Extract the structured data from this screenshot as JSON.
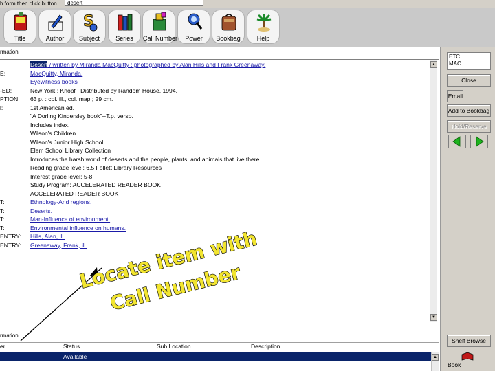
{
  "top_bar": {
    "prompt": "h form then click button",
    "search_value": "desert"
  },
  "toolbar": {
    "buttons": [
      {
        "label": "Title",
        "icon": "book-icon"
      },
      {
        "label": "Author",
        "icon": "pen-icon"
      },
      {
        "label": "Subject",
        "icon": "subject-icon"
      },
      {
        "label": "Series",
        "icon": "books-icon"
      },
      {
        "label": "Call Number",
        "icon": "call-number-icon"
      },
      {
        "label": "Power",
        "icon": "power-icon"
      },
      {
        "label": "Bookbag",
        "icon": "bookbag-icon"
      },
      {
        "label": "Help",
        "icon": "help-icon"
      }
    ]
  },
  "detail": {
    "section_title": "rmation",
    "rows": [
      {
        "label": "",
        "value": "Desert / written by Miranda MacQuitty ; photographed by Alan Hills and Frank Greenaway.",
        "link": true,
        "highlight_word": "Desert"
      },
      {
        "label": "E:",
        "value": "MacQuitty, Miranda.",
        "link": true
      },
      {
        "label": "",
        "value": "Eyewitness books",
        "link": true
      },
      {
        "label": "-ED:",
        "value": "New York : Knopf : Distributed by Random House, 1994.",
        "link": false
      },
      {
        "label": "PTION:",
        "value": "63 p. : col. ill., col. map ; 29 cm.",
        "link": false
      },
      {
        "label": "l:",
        "value": "1st American ed.",
        "link": false
      },
      {
        "label": "",
        "value": "\"A Dorling Kindersley book\"--T.p. verso.",
        "link": false
      },
      {
        "label": "",
        "value": "Includes index.",
        "link": false
      },
      {
        "label": "",
        "value": "Wilson's Children",
        "link": false
      },
      {
        "label": "",
        "value": "Wilson's Junior High School",
        "link": false
      },
      {
        "label": "",
        "value": "Elem School Library Collection",
        "link": false
      },
      {
        "label": "",
        "value": "Introduces the harsh world of deserts and the people, plants, and animals that live there.",
        "link": false
      },
      {
        "label": "",
        "value": "Reading grade level: 6.5 Follett Library Resources",
        "link": false
      },
      {
        "label": "",
        "value": "Interest grade level: 5-8",
        "link": false
      },
      {
        "label": "",
        "value": "Study Program: ACCELERATED READER BOOK",
        "link": false
      },
      {
        "label": "",
        "value": "ACCELERATED READER BOOK",
        "link": false
      },
      {
        "label": "T:",
        "value": "Ethnology-Arid regions.",
        "link": true
      },
      {
        "label": "T:",
        "value": "Deserts.",
        "link": true
      },
      {
        "label": "T:",
        "value": "Man-Influence of environment.",
        "link": true
      },
      {
        "label": "T:",
        "value": "Environmental influence on humans.",
        "link": true
      },
      {
        "label": "ENTRY:",
        "value": "Hills, Alan, ill.",
        "link": true
      },
      {
        "label": "ENTRY:",
        "value": "Greenaway, Frank, ill.",
        "link": true
      }
    ]
  },
  "right_panel": {
    "info_lines": [
      "ETC",
      "MAC"
    ],
    "buttons": {
      "close": "Close",
      "email": "Email",
      "add_bookbag": "Add to Bookbag",
      "hold": "Hold/Reserve"
    },
    "shelf_browse": "Shelf Browse",
    "book_label": "Book"
  },
  "copies": {
    "title": "rmation",
    "headers": {
      "col1": "er",
      "status": "Status",
      "sublocation": "Sub Location",
      "description": "Description"
    },
    "row": {
      "col1": "",
      "status": "Available",
      "sublocation": "",
      "description": ""
    }
  },
  "annotation": {
    "line1": "Locate item with",
    "line2": "Call Number"
  },
  "colors": {
    "toolbar_bg": "#c9c9c9",
    "link": "#1a1aa8",
    "selection": "#0a246a",
    "arrow_green": "#1db31d",
    "annotation_fill": "#f2e530"
  }
}
